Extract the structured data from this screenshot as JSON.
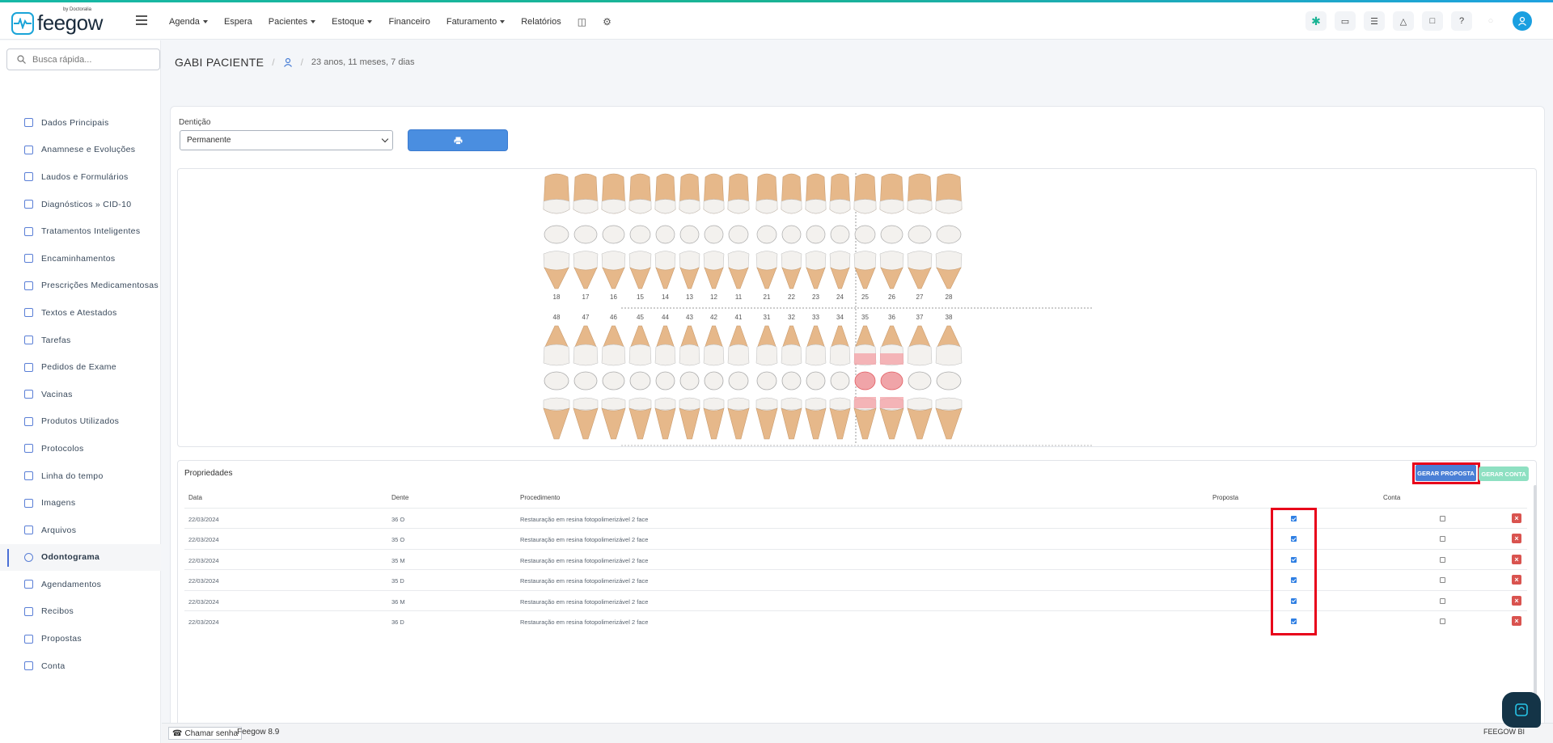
{
  "brand": {
    "name": "feegow",
    "sub": "by Doctoralia"
  },
  "nav": [
    {
      "label": "Agenda",
      "dropdown": true
    },
    {
      "label": "Espera",
      "dropdown": false
    },
    {
      "label": "Pacientes",
      "dropdown": true
    },
    {
      "label": "Estoque",
      "dropdown": true
    },
    {
      "label": "Financeiro",
      "dropdown": false
    },
    {
      "label": "Faturamento",
      "dropdown": true
    },
    {
      "label": "Relatórios",
      "dropdown": false
    }
  ],
  "search": {
    "placeholder": "Busca rápida..."
  },
  "sidebar": {
    "items": [
      {
        "label": "Dados Principais",
        "icon": "user-icon"
      },
      {
        "label": "Anamnese e Evoluções",
        "icon": "chart-icon"
      },
      {
        "label": "Laudos e Formulários",
        "icon": "clipboard-icon"
      },
      {
        "label": "Diagnósticos » CID-10",
        "icon": "stethoscope-icon"
      },
      {
        "label": "Tratamentos Inteligentes",
        "icon": "stethoscope-icon"
      },
      {
        "label": "Encaminhamentos",
        "icon": "document-icon"
      },
      {
        "label": "Prescrições Medicamentosas",
        "icon": "pills-icon"
      },
      {
        "label": "Textos e Atestados",
        "icon": "document-icon"
      },
      {
        "label": "Tarefas",
        "icon": "list-icon"
      },
      {
        "label": "Pedidos de Exame",
        "icon": "clipboard-icon"
      },
      {
        "label": "Vacinas",
        "icon": "syringe-icon"
      },
      {
        "label": "Produtos Utilizados",
        "icon": "box-icon"
      },
      {
        "label": "Protocolos",
        "icon": "clipboard-icon"
      },
      {
        "label": "Linha do tempo",
        "icon": "timeline-icon"
      },
      {
        "label": "Imagens",
        "icon": "camera-icon"
      },
      {
        "label": "Arquivos",
        "icon": "file-icon"
      },
      {
        "label": "Odontograma",
        "icon": "globe-icon",
        "active": true
      },
      {
        "label": "Agendamentos",
        "icon": "calendar-icon"
      },
      {
        "label": "Recibos",
        "icon": "receipt-icon"
      },
      {
        "label": "Propostas",
        "icon": "document-icon"
      },
      {
        "label": "Conta",
        "icon": "wallet-icon"
      }
    ]
  },
  "patient": {
    "name": "GABI PACIENTE",
    "age": "23 anos, 11 meses, 7 dias"
  },
  "denticao": {
    "label": "Dentição",
    "value": "Permanente"
  },
  "teeth": {
    "upper": [
      "18",
      "17",
      "16",
      "15",
      "14",
      "13",
      "12",
      "11",
      "21",
      "22",
      "23",
      "24",
      "25",
      "26",
      "27",
      "28"
    ],
    "lower": [
      "48",
      "47",
      "46",
      "45",
      "44",
      "43",
      "42",
      "41",
      "31",
      "32",
      "33",
      "34",
      "35",
      "36",
      "37",
      "38"
    ],
    "marked_lower": [
      "35",
      "36"
    ]
  },
  "props": {
    "title": "Propriedades",
    "btn_proposta": "GERAR PROPOSTA",
    "btn_conta": "GERAR CONTA",
    "headers": {
      "data": "Data",
      "dente": "Dente",
      "procedimento": "Procedimento",
      "proposta": "Proposta",
      "conta": "Conta"
    },
    "rows": [
      {
        "data": "22/03/2024",
        "dente": "36 O",
        "procedimento": "Restauração em resina fotopolimerizável 2 face",
        "proposta": true,
        "conta": false
      },
      {
        "data": "22/03/2024",
        "dente": "35 O",
        "procedimento": "Restauração em resina fotopolimerizável 2 face",
        "proposta": true,
        "conta": false
      },
      {
        "data": "22/03/2024",
        "dente": "35 M",
        "procedimento": "Restauração em resina fotopolimerizável 2 face",
        "proposta": true,
        "conta": false
      },
      {
        "data": "22/03/2024",
        "dente": "35 D",
        "procedimento": "Restauração em resina fotopolimerizável 2 face",
        "proposta": true,
        "conta": false
      },
      {
        "data": "22/03/2024",
        "dente": "36 M",
        "procedimento": "Restauração em resina fotopolimerizável 2 face",
        "proposta": true,
        "conta": false
      },
      {
        "data": "22/03/2024",
        "dente": "36 D",
        "procedimento": "Restauração em resina fotopolimerizável 2 face",
        "proposta": true,
        "conta": false
      }
    ]
  },
  "footer": {
    "chamar": "Chamar senha",
    "version": "Feegow 8.9",
    "bi": "FEEGOW BI"
  },
  "colors": {
    "accent": "#4a7fd6",
    "highlight": "#e8001a",
    "teal": "#1ab394",
    "tooth": "#e6b88a"
  }
}
